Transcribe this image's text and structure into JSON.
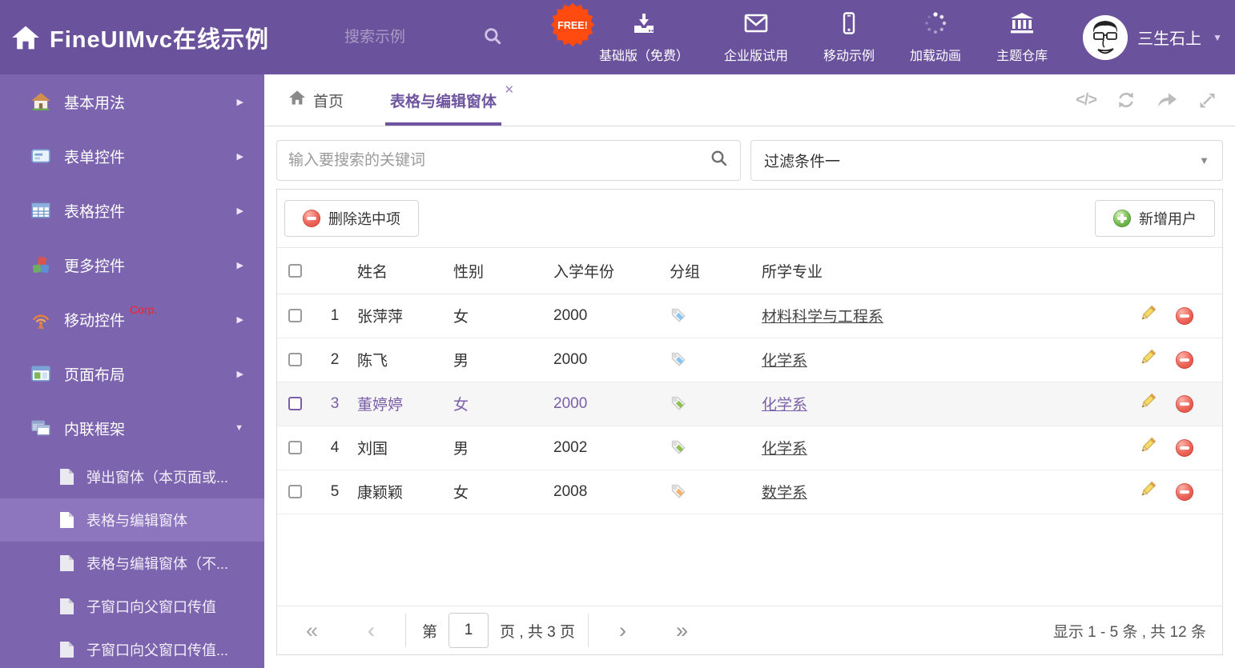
{
  "colors": {
    "header_bg": "#6b529c",
    "sidebar_bg": "#7c64ae",
    "sidebar_selected_bg": "#8d76bd",
    "accent_purple": "#6f55a0",
    "selected_row_text": "#7a5fa8",
    "free_badge_bg": "#ff4a10",
    "delete_red": "#e9574c",
    "add_green": "#56a33c",
    "tag_blue": "#86c5f4",
    "tag_green": "#8dc153",
    "tag_orange": "#f6b26b"
  },
  "header": {
    "logo_text": "FineUIMvc在线示例",
    "search_placeholder": "搜索示例",
    "free_badge": "FREE!",
    "nav_items": [
      {
        "label": "基础版（免费）",
        "icon": "download-icon"
      },
      {
        "label": "企业版试用",
        "icon": "envelope-icon"
      },
      {
        "label": "移动示例",
        "icon": "mobile-icon"
      },
      {
        "label": "加载动画",
        "icon": "spinner-icon"
      },
      {
        "label": "主题仓库",
        "icon": "bank-icon"
      }
    ],
    "user_name": "三生石上"
  },
  "sidebar": {
    "items": [
      {
        "label": "基本用法",
        "icon": "home-icon"
      },
      {
        "label": "表单控件",
        "icon": "form-icon"
      },
      {
        "label": "表格控件",
        "icon": "table-icon"
      },
      {
        "label": "更多控件",
        "icon": "cubes-icon"
      },
      {
        "label": "移动控件",
        "badge": "Corp.",
        "icon": "antenna-icon"
      },
      {
        "label": "页面布局",
        "icon": "layout-icon"
      },
      {
        "label": "内联框架",
        "icon": "frames-icon",
        "expanded": true
      }
    ],
    "subitems": [
      {
        "label": "弹出窗体（本页面或...",
        "icon": "page-icon"
      },
      {
        "label": "表格与编辑窗体",
        "icon": "page-icon",
        "selected": true
      },
      {
        "label": "表格与编辑窗体（不...",
        "icon": "page-icon"
      },
      {
        "label": "子窗口向父窗口传值",
        "icon": "page-icon"
      },
      {
        "label": "子窗口向父窗口传值...",
        "icon": "page-icon"
      }
    ]
  },
  "tabs": [
    {
      "label": "首页",
      "icon": "home-icon"
    },
    {
      "label": "表格与编辑窗体",
      "active": true,
      "closable": true
    }
  ],
  "tab_tools": [
    "code-icon",
    "refresh-icon",
    "share-icon",
    "expand-icon"
  ],
  "filter": {
    "search_placeholder": "输入要搜索的关键词",
    "dropdown_value": "过滤条件一"
  },
  "toolbar": {
    "delete_label": "删除选中项",
    "add_label": "新增用户"
  },
  "table": {
    "columns": [
      "姓名",
      "性别",
      "入学年份",
      "分组",
      "所学专业"
    ],
    "rows": [
      {
        "num": "1",
        "name": "张萍萍",
        "gender": "女",
        "year": "2000",
        "tag_color": "#86c5f4",
        "major": "材料科学与工程系",
        "selected": false
      },
      {
        "num": "2",
        "name": "陈飞",
        "gender": "男",
        "year": "2000",
        "tag_color": "#86c5f4",
        "major": "化学系",
        "selected": false
      },
      {
        "num": "3",
        "name": "董婷婷",
        "gender": "女",
        "year": "2000",
        "tag_color": "#8dc153",
        "major": "化学系",
        "selected": true
      },
      {
        "num": "4",
        "name": "刘国",
        "gender": "男",
        "year": "2002",
        "tag_color": "#8dc153",
        "major": "化学系",
        "selected": false
      },
      {
        "num": "5",
        "name": "康颖颖",
        "gender": "女",
        "year": "2008",
        "tag_color": "#f6b26b",
        "major": "数学系",
        "selected": false
      }
    ]
  },
  "pagination": {
    "first": "«",
    "prev": "‹",
    "next": "›",
    "last": "»",
    "page_word": "第",
    "page_value": "1",
    "page_suffix": "页 , 共 3 页",
    "summary": "显示 1 - 5 条 , 共 12 条"
  }
}
